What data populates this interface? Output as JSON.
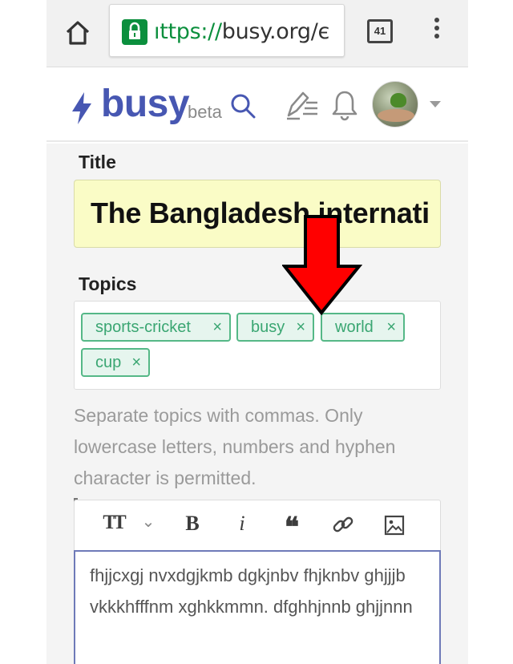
{
  "browser": {
    "url_scheme": "ıttps://",
    "url_rest": "busy.org/є",
    "tab_count": "41"
  },
  "app": {
    "brand": "busy",
    "beta": "beta"
  },
  "editor": {
    "title_label": "Title",
    "title_value": "The Bangladesh internati",
    "topics_label": "Topics",
    "tags": [
      "sports-cricket",
      "busy",
      "world",
      "cup"
    ],
    "tag_remove": "×",
    "help_text": "Separate topics with commas. Only lowercase letters, numbers and hyphen character is permitted.",
    "toolbar": {
      "heading": "TT",
      "heading_caret": "⌄",
      "bold": "B",
      "italic": "i",
      "quote": "❝"
    },
    "body": "fhjjcxgj nvxdgjkmb dgkjnbv fhjknbv ghjjjb vkkkhfffnm xghkkmmn. dfghhjnnb ghjjnnn"
  },
  "colors": {
    "brand": "#4757b2",
    "tag_green": "#3aa672",
    "title_bg": "#fafcc6",
    "arrow_red": "#ff0000"
  }
}
